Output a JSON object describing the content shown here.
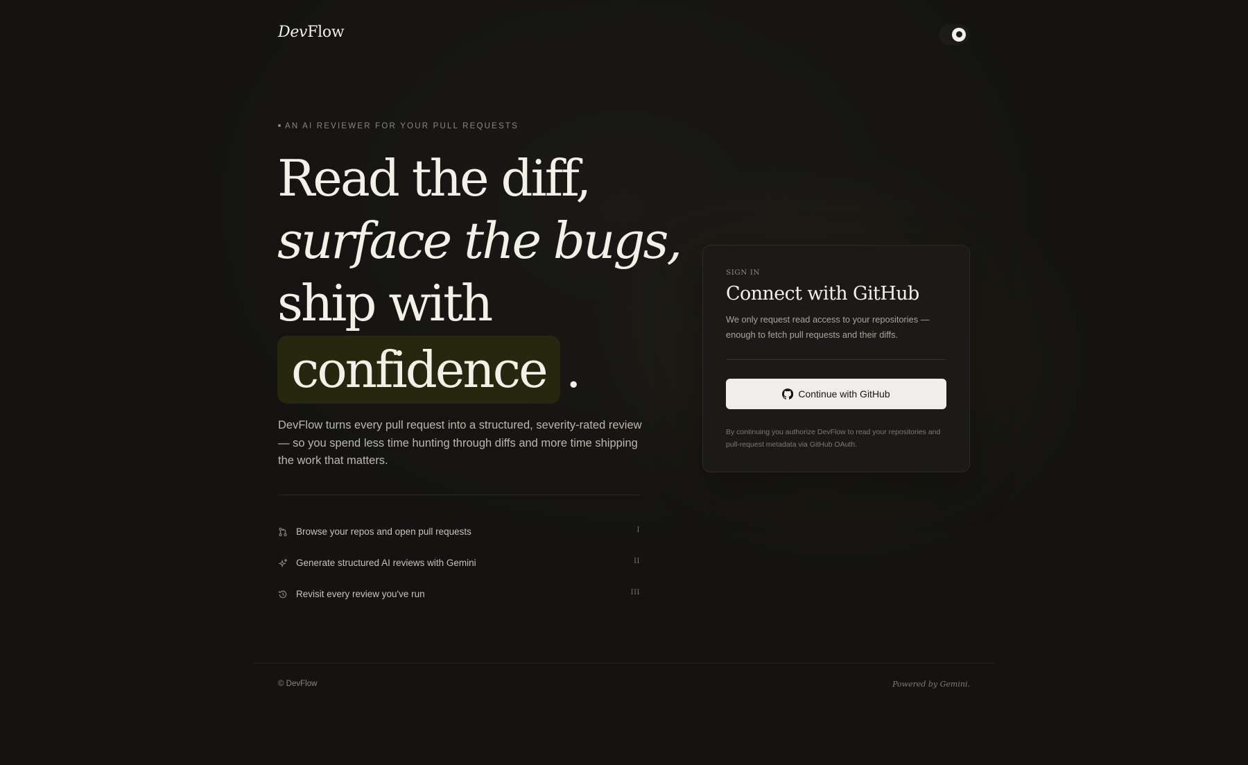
{
  "header": {
    "logo_italic": "Dev",
    "logo_rest": "Flow",
    "theme_toggle_icon": "moon-icon"
  },
  "hero": {
    "eyebrow": "AN AI REVIEWER FOR YOUR PULL REQUESTS",
    "headline": {
      "line1": "Read the diff,",
      "line2": "surface the bugs,",
      "line3": "ship with",
      "highlight": "confidence",
      "end": "."
    },
    "lede": "DevFlow turns every pull request into a structured, severity-rated review — so you spend less time hunting through diffs and more time shipping the work that matters.",
    "features": [
      {
        "icon": "pull-request-icon",
        "text": "Browse your repos and open pull requests",
        "num": "I"
      },
      {
        "icon": "sparkle-icon",
        "text": "Generate structured AI reviews with Gemini",
        "num": "II"
      },
      {
        "icon": "history-icon",
        "text": "Revisit every review you've run",
        "num": "III"
      }
    ]
  },
  "signin": {
    "label": "SIGN IN",
    "title": "Connect with GitHub",
    "description": "We only request read access to your repositories — enough to fetch pull requests and their diffs.",
    "button_label": "Continue with GitHub",
    "button_icon": "github-icon",
    "fine_print": "By continuing you authorize DevFlow to read your repositories and pull-request metadata via GitHub OAuth."
  },
  "footer": {
    "copyright": "© DevFlow",
    "powered": "Powered by Gemini."
  },
  "colors": {
    "background": "#141311",
    "card": "#1b1a18",
    "highlight": "#27270f",
    "button": "#efeeea",
    "text": "#f3f0e8"
  }
}
